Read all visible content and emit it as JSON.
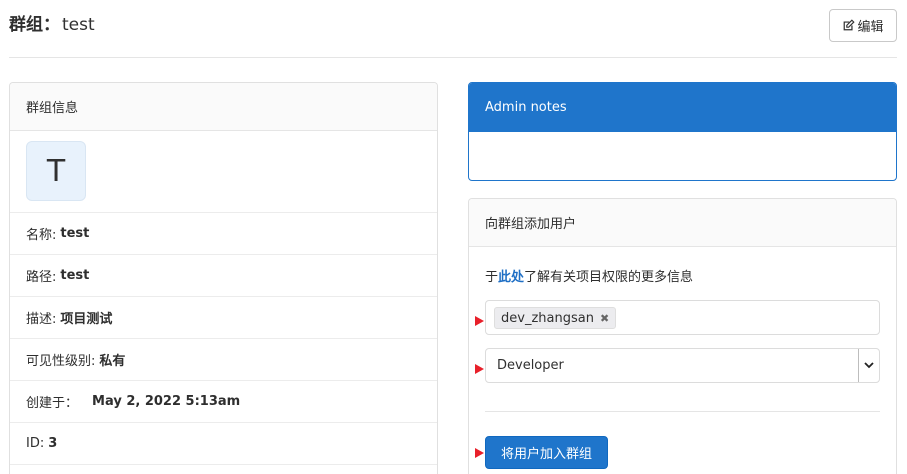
{
  "header": {
    "title_prefix": "群组：",
    "title_name": "test",
    "edit_label": "编辑"
  },
  "group_info": {
    "heading": "群组信息",
    "avatar_letter": "T",
    "rows": {
      "name": {
        "label": "名称:",
        "value": "test"
      },
      "path": {
        "label": "路径:",
        "value": "test"
      },
      "description": {
        "label": "描述:",
        "value": "项目测试"
      },
      "visibility": {
        "label": "可见性级别:",
        "value": "私有"
      },
      "created": {
        "label": "创建于：",
        "value": "May 2, 2022 5:13am"
      },
      "id": {
        "label": "ID:",
        "value": "3"
      }
    }
  },
  "admin_notes": {
    "heading": "Admin notes"
  },
  "add_users": {
    "heading": "向群组添加用户",
    "help_prefix": "于",
    "help_link": "此处",
    "help_suffix": "了解有关项目权限的更多信息",
    "selected_user": "dev_zhangsan",
    "role_selected": "Developer",
    "submit_label": "将用户加入群组"
  },
  "colors": {
    "primary": "#1f75cb",
    "marker": "#e8202a"
  }
}
